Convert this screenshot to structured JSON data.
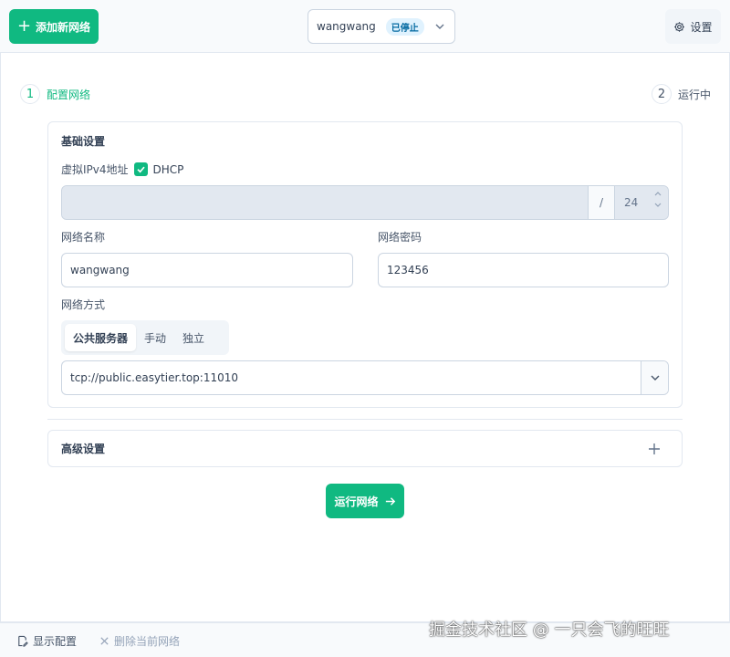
{
  "header": {
    "add_network_label": "添加新网络",
    "network_name": "wangwang",
    "status_badge": "已停止",
    "settings_label": "设置"
  },
  "steps": [
    {
      "num": "1",
      "label": "配置网络"
    },
    {
      "num": "2",
      "label": "运行中"
    }
  ],
  "basic": {
    "title": "基础设置",
    "ipv4_label": "虚拟IPv4地址",
    "dhcp_label": "DHCP",
    "dhcp_checked": true,
    "ip_value": "",
    "slash": "/",
    "mask": "24",
    "network_name_label": "网络名称",
    "network_name_value": "wangwang",
    "network_secret_label": "网络密码",
    "network_secret_value": "123456",
    "mode_label": "网络方式",
    "mode_options": [
      "公共服务器",
      "手动",
      "独立"
    ],
    "mode_selected": "公共服务器",
    "server_url": "tcp://public.easytier.top:11010"
  },
  "advanced": {
    "title": "高级设置"
  },
  "run_button": "运行网络",
  "footer": {
    "show_config": "显示配置",
    "delete_network": "删除当前网络"
  },
  "watermark": "掘金技术社区 @ 一只会飞的旺旺",
  "colors": {
    "accent": "#10b981",
    "badge_bg": "#e0f2fe",
    "badge_fg": "#0369a1"
  }
}
